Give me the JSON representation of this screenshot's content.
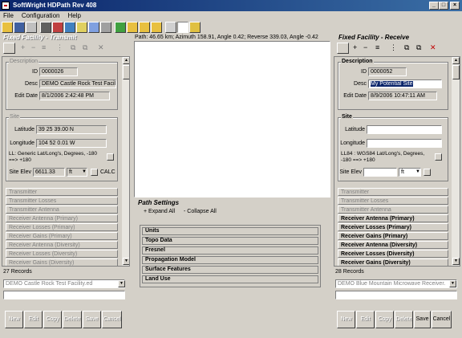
{
  "window": {
    "title": "SoftWright HDPath Rev 408"
  },
  "menu": [
    "File",
    "Configuration",
    "Help"
  ],
  "path_info": "Path: 46.65 km; Azimuth 158.91, Angle 0.42; Reverse 339.03, Angle -0.42",
  "left": {
    "title": "Fixed Facility - Transmit",
    "description_label": "Description",
    "id_label": "ID",
    "id_value": "0000026",
    "desc_label": "Desc",
    "desc_value": "DEMO Castle Rock Test Facilit",
    "edit_date_label": "Edit Date",
    "edit_date_value": "8/1/2006 2:42:48 PM",
    "site_label": "Site",
    "latitude_label": "Latitude",
    "latitude_value": "39 25 39.00 N",
    "longitude_label": "Longitude",
    "longitude_value": "104 52 0.01 W",
    "ll_text": "LL: Generic Lat/Long's, Degrees, -180 ==> +180",
    "site_elev_label": "Site Elev",
    "site_elev_value": "6611.33",
    "unit": "ft",
    "calc": "CALC",
    "sections": [
      "Transmitter",
      "Transmitter Losses",
      "Transmitter Antenna",
      "Receiver Antenna (Primary)",
      "Receiver Losses (Primary)",
      "Receiver Gains (Primary)",
      "Receiver Antenna (Diversity)",
      "Receiver Losses (Diversity)",
      "Receiver Gains (Diversity)"
    ],
    "records": "27 Records",
    "combo": "DEMO Castle Rock Test Facility.ed"
  },
  "right": {
    "title": "Fixed Facility - Receive",
    "description_label": "Description",
    "id_label": "ID",
    "id_value": "0000052",
    "desc_label": "Desc",
    "desc_value": "My Potential Site",
    "edit_date_label": "Edit Date",
    "edit_date_value": "8/9/2006 10:47:11 AM",
    "site_label": "Site",
    "latitude_label": "Latitude",
    "latitude_value": "",
    "longitude_label": "Longitude",
    "longitude_value": "",
    "ll_text": "LL84 : WGS84 Lat/Long's, Degrees, -180 ==> +180",
    "site_elev_label": "Site Elev",
    "site_elev_value": "",
    "unit": "ft",
    "sections": [
      "Transmitter",
      "Transmitter Losses",
      "Transmitter Antenna",
      "Receiver Antenna (Primary)",
      "Receiver Losses (Primary)",
      "Receiver Gains (Primary)",
      "Receiver Antenna (Diversity)",
      "Receiver Losses (Diversity)",
      "Receiver Gains (Diversity)"
    ],
    "records": "28 Records",
    "combo": "DEMO Blue Mountain Microwave Receiver."
  },
  "path_settings": {
    "title": "Path Settings",
    "expand_all": "+ Expand All",
    "collapse_all": "- Collapse All",
    "items": [
      "Units",
      "Topo Data",
      "Fresnel",
      "Propagation Model",
      "Surface Features",
      "Land Use"
    ]
  },
  "buttons": {
    "new": "New",
    "edit": "Edit",
    "copy": "Copy",
    "delete": "Delete",
    "save": "Save",
    "cancel": "Cancel"
  }
}
